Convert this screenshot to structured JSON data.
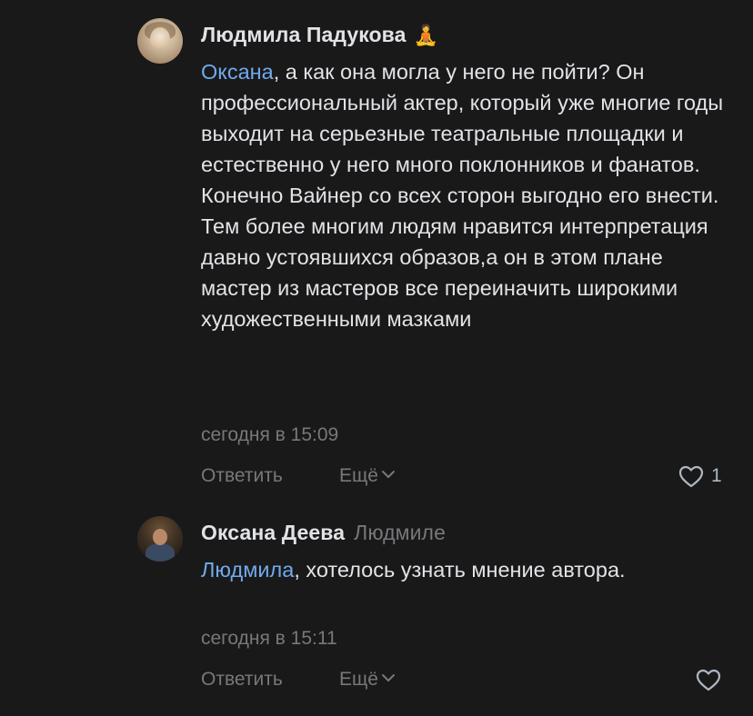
{
  "comments": [
    {
      "author": "Людмила Падукова",
      "author_emoji": "🧘",
      "mention": "Оксана",
      "text": ", а как она могла у него не пойти? Он профессиональный актер, который уже многие годы выходит на серьезные театральные площадки и естественно у него много поклонников и фанатов. Конечно Вайнер со всех сторон выгодно его внести. Тем более многим людям нравится интерпретация давно устоявшихся образов,а он в этом плане мастер из мастеров все переиначить широкими художественными мазками",
      "time": "сегодня в 15:09",
      "reply_label": "Ответить",
      "more_label": "Ещё",
      "likes": "1"
    },
    {
      "author": "Оксана Деева",
      "reply_to": "Людмиле",
      "mention": "Людмила",
      "text": ", хотелось узнать мнение автора.",
      "time": "сегодня в 15:11",
      "reply_label": "Ответить",
      "more_label": "Ещё",
      "likes": ""
    }
  ],
  "colors": {
    "background": "#19191a",
    "text": "#e1e3e6",
    "secondary": "#76787a",
    "link": "#71aaeb"
  },
  "icons": {
    "like": "heart-outline-icon",
    "more": "chevron-down-icon"
  }
}
